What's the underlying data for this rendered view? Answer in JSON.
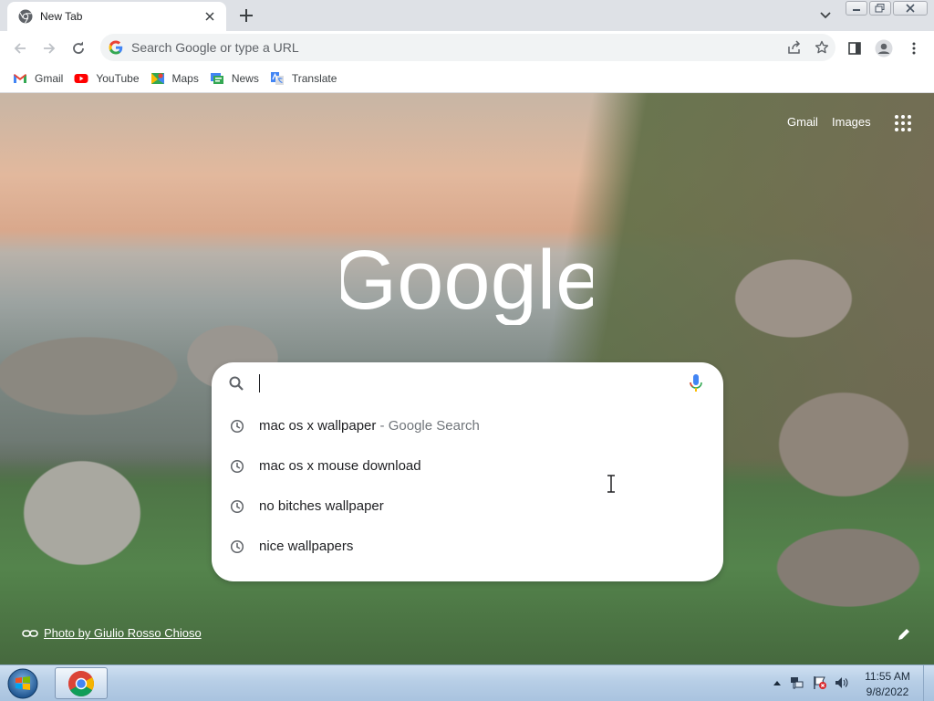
{
  "browser": {
    "tab": {
      "title": "New Tab",
      "icon": "chrome-icon"
    },
    "window_controls": [
      "minimize",
      "maximize",
      "close"
    ]
  },
  "toolbar": {
    "omnibox_placeholder": "Search Google or type a URL"
  },
  "bookmarks": [
    {
      "label": "Gmail",
      "icon": "gmail-icon"
    },
    {
      "label": "YouTube",
      "icon": "youtube-icon"
    },
    {
      "label": "Maps",
      "icon": "maps-icon"
    },
    {
      "label": "News",
      "icon": "news-icon"
    },
    {
      "label": "Translate",
      "icon": "translate-icon"
    }
  ],
  "ntp": {
    "links": {
      "gmail": "Gmail",
      "images": "Images"
    },
    "logo_text": "Google",
    "suggestions": [
      {
        "text": "mac os x wallpaper",
        "suffix": " - Google Search"
      },
      {
        "text": "mac os x mouse download",
        "suffix": ""
      },
      {
        "text": "no bitches wallpaper",
        "suffix": ""
      },
      {
        "text": "nice wallpapers",
        "suffix": ""
      }
    ],
    "photo_credit": "Photo by Giulio Rosso Chioso"
  },
  "taskbar": {
    "time": "11:55 AM",
    "date": "9/8/2022"
  },
  "colors": {
    "tabstrip": "#dee1e6",
    "omnibox": "#f1f3f4",
    "google_blue": "#4285f4",
    "google_red": "#ea4335",
    "google_yellow": "#fbbc05",
    "google_green": "#34a853"
  }
}
